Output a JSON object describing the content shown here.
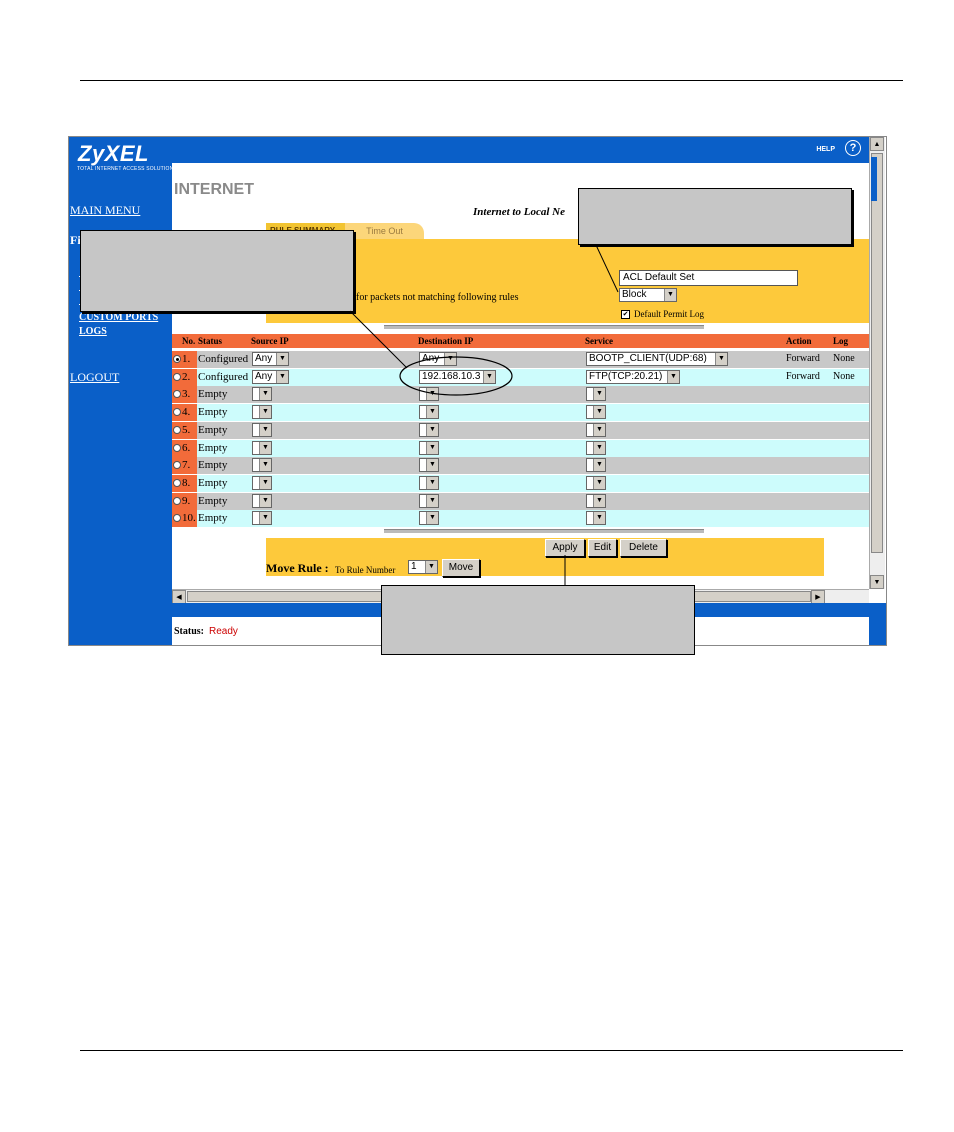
{
  "brand": {
    "logo": "ZyXEL",
    "tagline": "TOTAL INTERNET ACCESS SOLUTION"
  },
  "sidebar": {
    "main_menu": "MAIN MENU",
    "section_initial": "Fi",
    "custom_ports": "CUSTOM PORTS",
    "logs": "LOGS",
    "logout": "LOGOUT"
  },
  "header": {
    "help": "HELP",
    "help_icon": "?"
  },
  "page": {
    "title": "INTERNET",
    "subtitle": "Internet to Local Ne"
  },
  "tabs": [
    {
      "label": "RULE SUMMARY"
    },
    {
      "label": "Time Out"
    }
  ],
  "settings": {
    "acl_name": "ACL Default Set",
    "default_action": "Block",
    "block_note": "for packets not matching following rules",
    "default_permit_log": "Default Permit Log"
  },
  "table": {
    "headers": {
      "no": "No.",
      "status": "Status",
      "source": "Source IP",
      "dest": "Destination IP",
      "service": "Service",
      "action": "Action",
      "log": "Log"
    },
    "rows": [
      {
        "no": "1.",
        "status": "Configured",
        "source": "Any",
        "dest": "Any",
        "service": "BOOTP_CLIENT(UDP:68)",
        "action": "Forward",
        "log": "None"
      },
      {
        "no": "2.",
        "status": "Configured",
        "source": "Any",
        "dest": "192.168.10.3",
        "service": "FTP(TCP:20.21)",
        "action": "Forward",
        "log": "None"
      },
      {
        "no": "3.",
        "status": "Empty",
        "source": "",
        "dest": "",
        "service": "",
        "action": "",
        "log": ""
      },
      {
        "no": "4.",
        "status": "Empty",
        "source": "",
        "dest": "",
        "service": "",
        "action": "",
        "log": ""
      },
      {
        "no": "5.",
        "status": "Empty",
        "source": "",
        "dest": "",
        "service": "",
        "action": "",
        "log": ""
      },
      {
        "no": "6.",
        "status": "Empty",
        "source": "",
        "dest": "",
        "service": "",
        "action": "",
        "log": ""
      },
      {
        "no": "7.",
        "status": "Empty",
        "source": "",
        "dest": "",
        "service": "",
        "action": "",
        "log": ""
      },
      {
        "no": "8.",
        "status": "Empty",
        "source": "",
        "dest": "",
        "service": "",
        "action": "",
        "log": ""
      },
      {
        "no": "9.",
        "status": "Empty",
        "source": "",
        "dest": "",
        "service": "",
        "action": "",
        "log": ""
      },
      {
        "no": "10.",
        "status": "Empty",
        "source": "",
        "dest": "",
        "service": "",
        "action": "",
        "log": ""
      }
    ]
  },
  "buttons": {
    "apply": "Apply",
    "edit": "Edit",
    "delete": "Delete",
    "move": "Move"
  },
  "move_rule": {
    "label": "Move Rule :",
    "to_label": "To Rule Number",
    "value": "1"
  },
  "status_bar": {
    "label": "Status:",
    "value": "Ready"
  },
  "colors": {
    "sidebar_blue": "#0a5fc8",
    "panel_yellow": "#fdc93b",
    "header_orange": "#f26b3a",
    "row_gray": "#c8c8c8",
    "row_cyan": "#cdfcfc",
    "status_red": "#cc0000"
  }
}
